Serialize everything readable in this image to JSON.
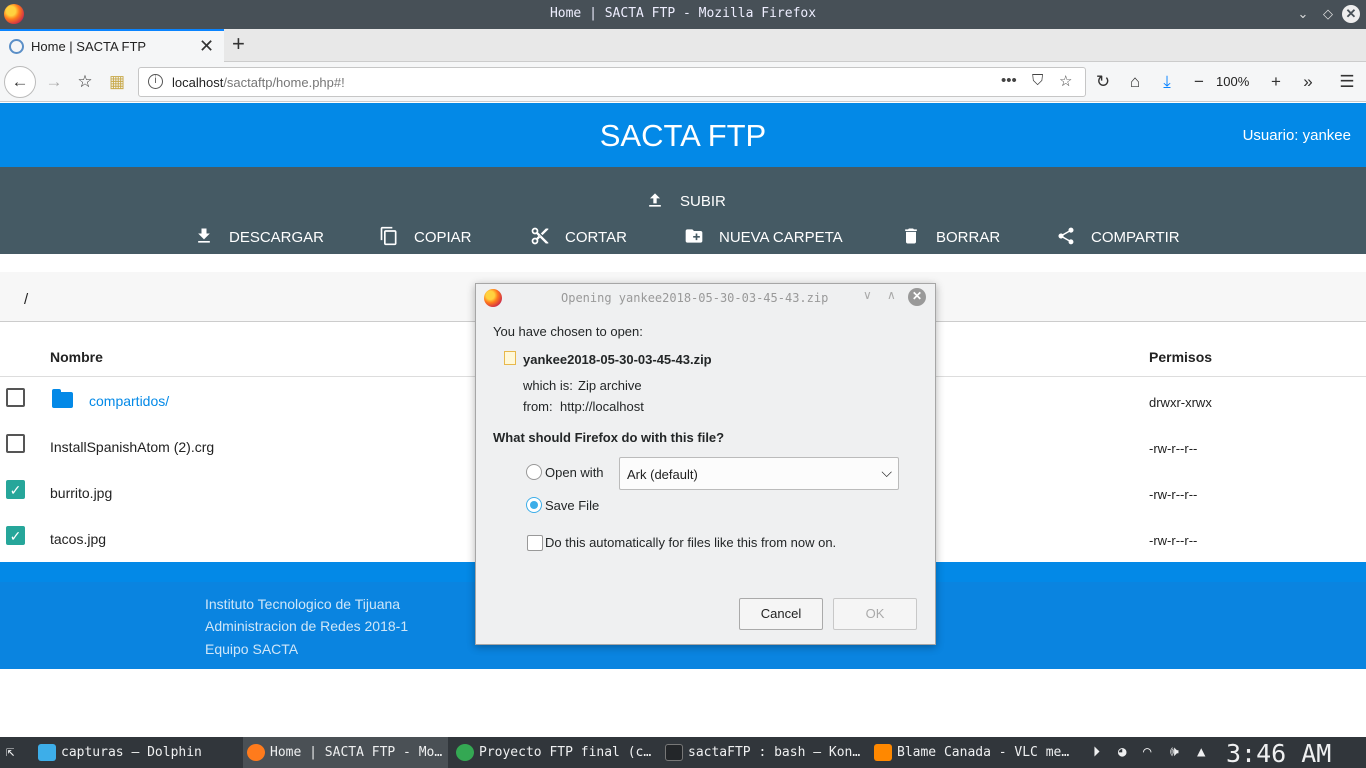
{
  "window": {
    "title": "Home | SACTA FTP - Mozilla Firefox"
  },
  "browser": {
    "tab_title": "Home | SACTA FTP",
    "url_host": "localhost",
    "url_path": "/sactaftp/home.php#!",
    "zoom": "100%"
  },
  "app": {
    "title": "SACTA FTP",
    "user": "Usuario: yankee",
    "toolbar": {
      "upload": "SUBIR",
      "download": "DESCARGAR",
      "copy": "COPIAR",
      "cut": "CORTAR",
      "new_folder": "NUEVA CARPETA",
      "delete": "BORRAR",
      "share": "COMPARTIR"
    },
    "path": "/",
    "table": {
      "col_name": "Nombre",
      "col_perms": "Permisos",
      "rows": [
        {
          "name": "compartidos/",
          "perms": "drwxr-xrwx",
          "checked": false,
          "folder": true
        },
        {
          "name": "InstallSpanishAtom (2).crg",
          "perms": "-rw-r--r--",
          "checked": false,
          "folder": false
        },
        {
          "name": "burrito.jpg",
          "perms": "-rw-r--r--",
          "checked": true,
          "folder": false
        },
        {
          "name": "tacos.jpg",
          "perms": "-rw-r--r--",
          "checked": true,
          "folder": false
        }
      ]
    },
    "footer": {
      "line1": "Instituto Tecnologico de Tijuana",
      "line2": "Administracion de Redes 2018-1",
      "line3": "Equipo SACTA"
    }
  },
  "dialog": {
    "title": "Opening yankee2018-05-30-03-45-43.zip",
    "chosen": "You have chosen to open:",
    "filename": "yankee2018-05-30-03-45-43.zip",
    "which_is_label": "which is:",
    "which_is_value": "Zip archive",
    "from_label": "from:",
    "from_value": "http://localhost",
    "question": "What should Firefox do with this file?",
    "open_with_label": "Open with",
    "open_with_app": "Ark (default)",
    "save_file_label": "Save File",
    "selected_action": "save",
    "auto_label": "Do this automatically for files like this from now on.",
    "cancel": "Cancel",
    "ok": "OK"
  },
  "taskbar": {
    "tasks": [
      {
        "label": "capturas — Dolphin",
        "color": "#3daee9"
      },
      {
        "label": "Home | SACTA FTP - Mo…",
        "color": "#ff7b1c"
      },
      {
        "label": "Proyecto FTP final (c…",
        "color": "#34a853"
      },
      {
        "label": "sactaFTP : bash — Kon…",
        "color": "#232629"
      },
      {
        "label": "Blame Canada - VLC me…",
        "color": "#ff8800"
      }
    ],
    "clock": "3:46 AM"
  }
}
